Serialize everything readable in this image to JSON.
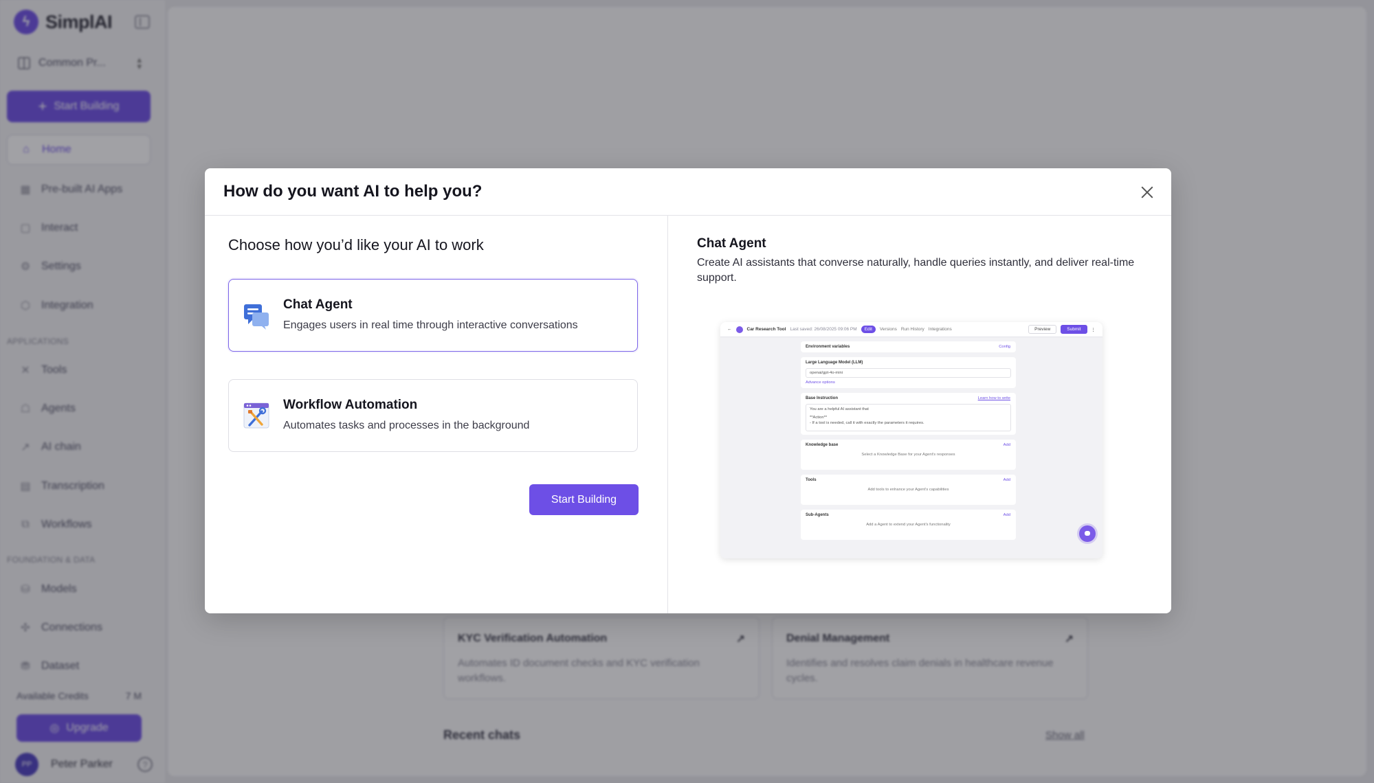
{
  "sidebar": {
    "brand": "SimplAI",
    "project": "Common Pr...",
    "start_building": "Start Building",
    "items": [
      {
        "label": "Home"
      },
      {
        "label": "Pre-built AI Apps"
      },
      {
        "label": "Interact"
      },
      {
        "label": "Settings"
      },
      {
        "label": "Integration"
      },
      {
        "label": "Tools"
      },
      {
        "label": "Agents"
      },
      {
        "label": "AI chain"
      },
      {
        "label": "Transcription"
      },
      {
        "label": "Workflows"
      },
      {
        "label": "Models"
      },
      {
        "label": "Connections"
      },
      {
        "label": "Dataset"
      }
    ],
    "section_applications": "APPLICATIONS",
    "section_foundation": "FOUNDATION & DATA",
    "credits_label": "Available Credits",
    "credits_value": "7 M",
    "upgrade": "Upgrade",
    "user_name": "Peter Parker",
    "user_initials": "PP"
  },
  "main": {
    "cards": [
      {
        "title": "KYC Verification Automation",
        "desc": "Automates ID document checks and KYC verification workflows."
      },
      {
        "title": "Denial Management",
        "desc": "Identifies and resolves claim denials in healthcare revenue cycles."
      }
    ],
    "recent_chats": "Recent chats",
    "show_all": "Show all"
  },
  "modal": {
    "title": "How do you want AI to help you?",
    "left_heading": "Choose how you’d like your AI to work",
    "options": [
      {
        "title": "Chat Agent",
        "desc": "Engages users in real time through interactive conversations",
        "icon": "chat-bubbles-icon"
      },
      {
        "title": "Workflow Automation",
        "desc": "Automates tasks and processes in the background",
        "icon": "tools-icon"
      }
    ],
    "start_button": "Start Building",
    "detail_title": "Chat Agent",
    "detail_desc": "Create AI assistants that converse naturally, handle queries instantly, and deliver real-time support."
  },
  "preview": {
    "app_title": "Car Research Tool",
    "last_saved": "Last saved: 26/08/2025 09:06 PM",
    "tabs": [
      "Edit",
      "Versions",
      "Run History",
      "Integrations"
    ],
    "preview_btn": "Preview",
    "submit_btn": "Submit",
    "env_vars": "Environment variables",
    "config": "Config",
    "llm_label": "Large Language Model (LLM)",
    "llm_value": "openai/gpt-4o-mini",
    "advance": "Advance options",
    "base_instruction": "Base Instruction",
    "learn_how": "Learn how to write",
    "instruction_text": "You are a helpful AI assistant that",
    "instruction_text2": "**Action**",
    "instruction_text3": "- If a tool is needed, call it with exactly the parameters it requires.",
    "knowledge_base": "Knowledge base",
    "add": "Add",
    "kb_hint": "Select a Knowledge Base for your Agent's responses",
    "tools": "Tools",
    "tools_hint": "Add tools to enhance your Agent's capabilities",
    "sub_agents": "Sub-Agents",
    "sub_hint": "Add a Agent to extend your Agent's functionality"
  },
  "colors": {
    "accent": "#6d4fe6"
  }
}
